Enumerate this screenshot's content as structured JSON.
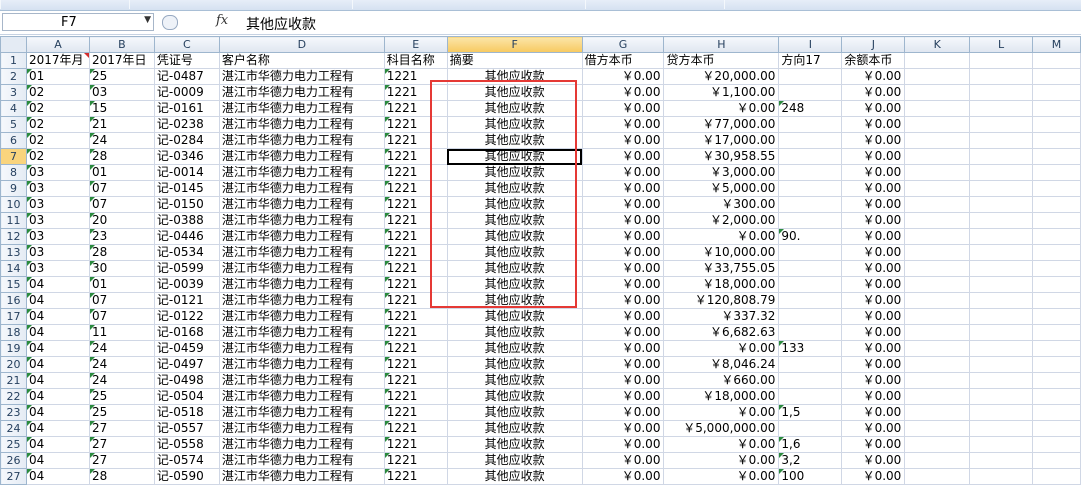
{
  "formula_bar": {
    "name_box": "F7",
    "fx_label": "fx",
    "content": "其他应收款"
  },
  "ribbon": {
    "groups": [
      {
        "name": "clipboard"
      },
      {
        "name": "font"
      },
      {
        "name": "alignment"
      },
      {
        "name": "number"
      },
      {
        "name": "styles"
      }
    ]
  },
  "columns": [
    "A",
    "B",
    "C",
    "D",
    "E",
    "F",
    "G",
    "H",
    "I",
    "J",
    "K",
    "L",
    "M"
  ],
  "selected_cell": {
    "column": "F",
    "row": "7"
  },
  "header_row": {
    "row_no": "1",
    "cells": [
      "2017年月",
      "2017年日",
      "凭证号",
      "客户名称",
      "科目名称",
      "摘要",
      "借方本币",
      "贷方本币",
      "方向17",
      "余额本币",
      "",
      "",
      ""
    ]
  },
  "rows": [
    {
      "n": "2",
      "month": "01",
      "day": "25",
      "voucher": "记-0487",
      "customer": "湛江市华德力电力工程有",
      "code": "1221",
      "summary": "其他应收款",
      "debit": "￥0.00",
      "credit": "￥20,000.00",
      "dir": "",
      "balance": "￥0.00"
    },
    {
      "n": "3",
      "month": "02",
      "day": "03",
      "voucher": "记-0009",
      "customer": "湛江市华德力电力工程有",
      "code": "1221",
      "summary": "其他应收款",
      "debit": "￥0.00",
      "credit": "￥1,100.00",
      "dir": "",
      "balance": "￥0.00"
    },
    {
      "n": "4",
      "month": "02",
      "day": "15",
      "voucher": "记-0161",
      "customer": "湛江市华德力电力工程有",
      "code": "1221",
      "summary": "其他应收款",
      "debit": "￥0.00",
      "credit": "￥0.00",
      "dir": "248",
      "balance": "￥0.00"
    },
    {
      "n": "5",
      "month": "02",
      "day": "21",
      "voucher": "记-0238",
      "customer": "湛江市华德力电力工程有",
      "code": "1221",
      "summary": "其他应收款",
      "debit": "￥0.00",
      "credit": "￥77,000.00",
      "dir": "",
      "balance": "￥0.00"
    },
    {
      "n": "6",
      "month": "02",
      "day": "24",
      "voucher": "记-0284",
      "customer": "湛江市华德力电力工程有",
      "code": "1221",
      "summary": "其他应收款",
      "debit": "￥0.00",
      "credit": "￥17,000.00",
      "dir": "",
      "balance": "￥0.00"
    },
    {
      "n": "7",
      "month": "02",
      "day": "28",
      "voucher": "记-0346",
      "customer": "湛江市华德力电力工程有",
      "code": "1221",
      "summary": "其他应收款",
      "debit": "￥0.00",
      "credit": "￥30,958.55",
      "dir": "",
      "balance": "￥0.00"
    },
    {
      "n": "8",
      "month": "03",
      "day": "01",
      "voucher": "记-0014",
      "customer": "湛江市华德力电力工程有",
      "code": "1221",
      "summary": "其他应收款",
      "debit": "￥0.00",
      "credit": "￥3,000.00",
      "dir": "",
      "balance": "￥0.00"
    },
    {
      "n": "9",
      "month": "03",
      "day": "07",
      "voucher": "记-0145",
      "customer": "湛江市华德力电力工程有",
      "code": "1221",
      "summary": "其他应收款",
      "debit": "￥0.00",
      "credit": "￥5,000.00",
      "dir": "",
      "balance": "￥0.00"
    },
    {
      "n": "10",
      "month": "03",
      "day": "07",
      "voucher": "记-0150",
      "customer": "湛江市华德力电力工程有",
      "code": "1221",
      "summary": "其他应收款",
      "debit": "￥0.00",
      "credit": "￥300.00",
      "dir": "",
      "balance": "￥0.00"
    },
    {
      "n": "11",
      "month": "03",
      "day": "20",
      "voucher": "记-0388",
      "customer": "湛江市华德力电力工程有",
      "code": "1221",
      "summary": "其他应收款",
      "debit": "￥0.00",
      "credit": "￥2,000.00",
      "dir": "",
      "balance": "￥0.00"
    },
    {
      "n": "12",
      "month": "03",
      "day": "23",
      "voucher": "记-0446",
      "customer": "湛江市华德力电力工程有",
      "code": "1221",
      "summary": "其他应收款",
      "debit": "￥0.00",
      "credit": "￥0.00",
      "dir": "90.",
      "balance": "￥0.00"
    },
    {
      "n": "13",
      "month": "03",
      "day": "28",
      "voucher": "记-0534",
      "customer": "湛江市华德力电力工程有",
      "code": "1221",
      "summary": "其他应收款",
      "debit": "￥0.00",
      "credit": "￥10,000.00",
      "dir": "",
      "balance": "￥0.00"
    },
    {
      "n": "14",
      "month": "03",
      "day": "30",
      "voucher": "记-0599",
      "customer": "湛江市华德力电力工程有",
      "code": "1221",
      "summary": "其他应收款",
      "debit": "￥0.00",
      "credit": "￥33,755.05",
      "dir": "",
      "balance": "￥0.00"
    },
    {
      "n": "15",
      "month": "04",
      "day": "01",
      "voucher": "记-0039",
      "customer": "湛江市华德力电力工程有",
      "code": "1221",
      "summary": "其他应收款",
      "debit": "￥0.00",
      "credit": "￥18,000.00",
      "dir": "",
      "balance": "￥0.00"
    },
    {
      "n": "16",
      "month": "04",
      "day": "07",
      "voucher": "记-0121",
      "customer": "湛江市华德力电力工程有",
      "code": "1221",
      "summary": "其他应收款",
      "debit": "￥0.00",
      "credit": "￥120,808.79",
      "dir": "",
      "balance": "￥0.00"
    },
    {
      "n": "17",
      "month": "04",
      "day": "07",
      "voucher": "记-0122",
      "customer": "湛江市华德力电力工程有",
      "code": "1221",
      "summary": "其他应收款",
      "debit": "￥0.00",
      "credit": "￥337.32",
      "dir": "",
      "balance": "￥0.00"
    },
    {
      "n": "18",
      "month": "04",
      "day": "11",
      "voucher": "记-0168",
      "customer": "湛江市华德力电力工程有",
      "code": "1221",
      "summary": "其他应收款",
      "debit": "￥0.00",
      "credit": "￥6,682.63",
      "dir": "",
      "balance": "￥0.00"
    },
    {
      "n": "19",
      "month": "04",
      "day": "24",
      "voucher": "记-0459",
      "customer": "湛江市华德力电力工程有",
      "code": "1221",
      "summary": "其他应收款",
      "debit": "￥0.00",
      "credit": "￥0.00",
      "dir": "133",
      "balance": "￥0.00"
    },
    {
      "n": "20",
      "month": "04",
      "day": "24",
      "voucher": "记-0497",
      "customer": "湛江市华德力电力工程有",
      "code": "1221",
      "summary": "其他应收款",
      "debit": "￥0.00",
      "credit": "￥8,046.24",
      "dir": "",
      "balance": "￥0.00"
    },
    {
      "n": "21",
      "month": "04",
      "day": "24",
      "voucher": "记-0498",
      "customer": "湛江市华德力电力工程有",
      "code": "1221",
      "summary": "其他应收款",
      "debit": "￥0.00",
      "credit": "￥660.00",
      "dir": "",
      "balance": "￥0.00"
    },
    {
      "n": "22",
      "month": "04",
      "day": "25",
      "voucher": "记-0504",
      "customer": "湛江市华德力电力工程有",
      "code": "1221",
      "summary": "其他应收款",
      "debit": "￥0.00",
      "credit": "￥18,000.00",
      "dir": "",
      "balance": "￥0.00"
    },
    {
      "n": "23",
      "month": "04",
      "day": "25",
      "voucher": "记-0518",
      "customer": "湛江市华德力电力工程有",
      "code": "1221",
      "summary": "其他应收款",
      "debit": "￥0.00",
      "credit": "￥0.00",
      "dir": "1,5",
      "balance": "￥0.00"
    },
    {
      "n": "24",
      "month": "04",
      "day": "27",
      "voucher": "记-0557",
      "customer": "湛江市华德力电力工程有",
      "code": "1221",
      "summary": "其他应收款",
      "debit": "￥0.00",
      "credit": "￥5,000,000.00",
      "dir": "",
      "balance": "￥0.00"
    },
    {
      "n": "25",
      "month": "04",
      "day": "27",
      "voucher": "记-0558",
      "customer": "湛江市华德力电力工程有",
      "code": "1221",
      "summary": "其他应收款",
      "debit": "￥0.00",
      "credit": "￥0.00",
      "dir": "1,6",
      "balance": "￥0.00"
    },
    {
      "n": "26",
      "month": "04",
      "day": "27",
      "voucher": "记-0574",
      "customer": "湛江市华德力电力工程有",
      "code": "1221",
      "summary": "其他应收款",
      "debit": "￥0.00",
      "credit": "￥0.00",
      "dir": "3,2",
      "balance": "￥0.00"
    },
    {
      "n": "27",
      "month": "04",
      "day": "28",
      "voucher": "记-0590",
      "customer": "湛江市华德力电力工程有",
      "code": "1221",
      "summary": "其他应收款",
      "debit": "￥0.00",
      "credit": "￥0.00",
      "dir": "100",
      "balance": "￥0.00"
    }
  ]
}
